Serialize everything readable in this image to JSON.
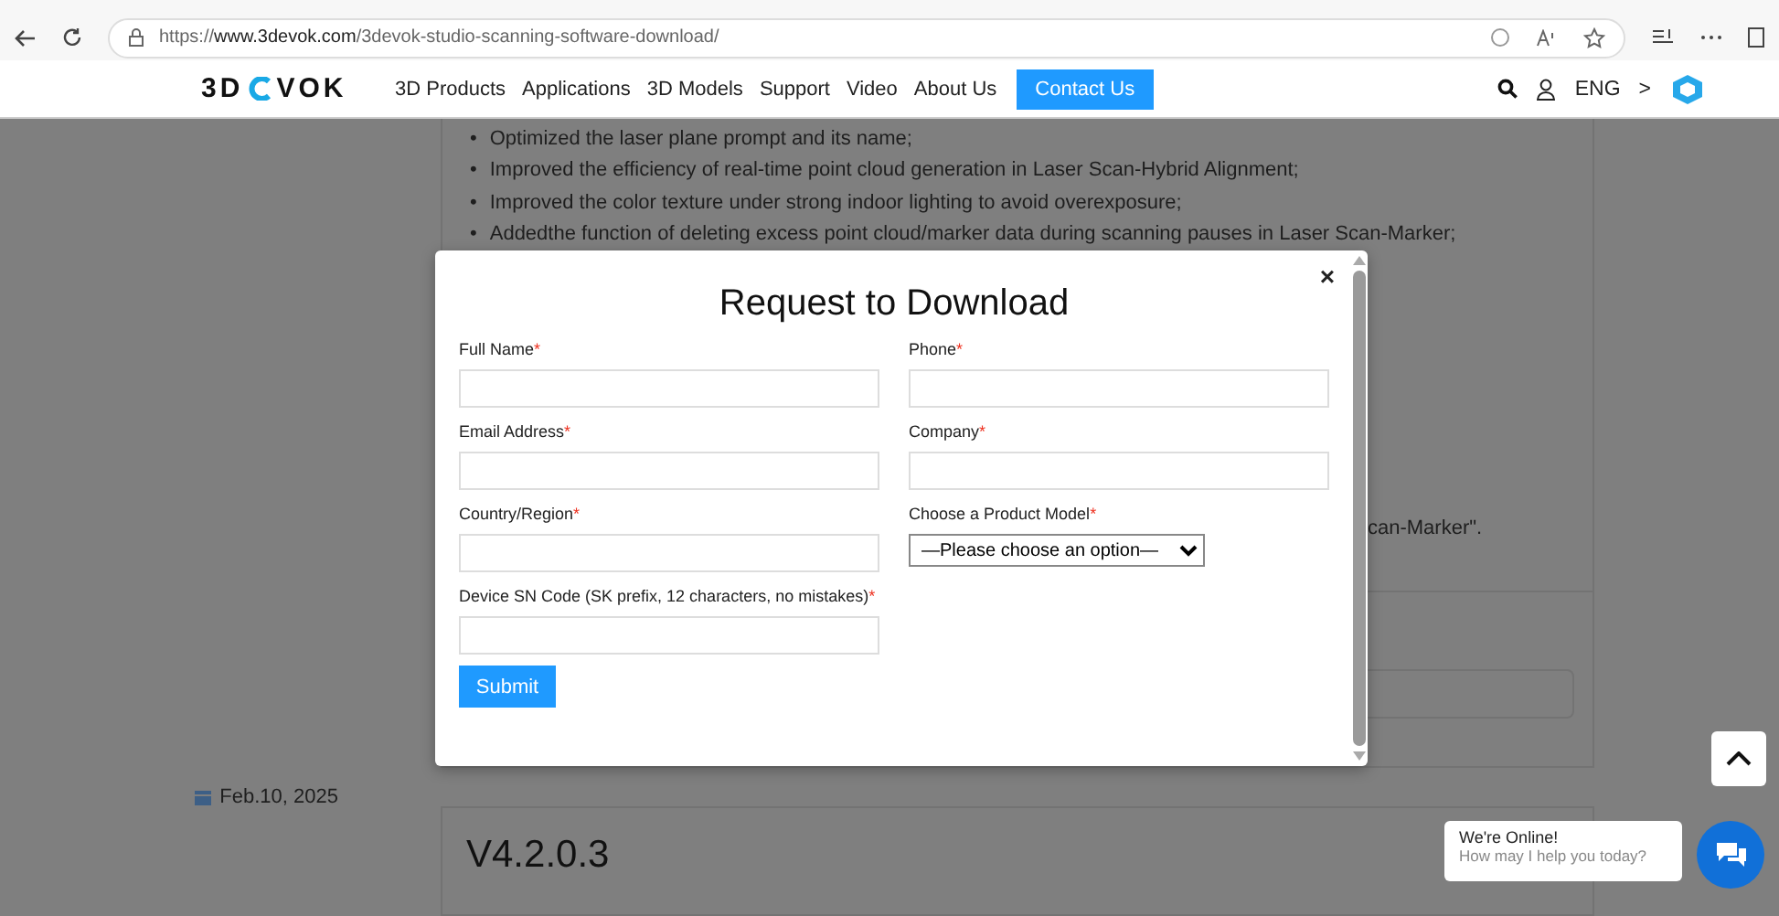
{
  "browser": {
    "url": "https://**www.3devok.com**/3devok-studio-scanning-software-download/"
  },
  "header": {
    "logo_left": "3D",
    "logo_right": "VOK",
    "nav": [
      {
        "label": "3D Products",
        "kind": "link"
      },
      {
        "label": "Applications",
        "kind": "link"
      },
      {
        "label": "3D Models",
        "kind": "link"
      },
      {
        "label": "Support",
        "kind": "link"
      },
      {
        "label": "Video",
        "kind": "link"
      },
      {
        "label": "About Us",
        "kind": "link"
      },
      {
        "label": "Contact Us",
        "kind": "button"
      }
    ],
    "language": "ENG",
    "language_arrow": ">"
  },
  "release_notes": {
    "marker": "•",
    "bullets": [
      "Optimized the laser plane prompt and its name;",
      "Improved the efficiency of real-time point cloud generation in Laser Scan-Hybrid Alignment;",
      "Improved the color texture under strong indoor lighting to avoid overexposure;",
      "Addedthe function of deleting excess point cloud/marker data during scanning pauses in Laser Scan-Marker;"
    ],
    "cut_text": "can-Marker\".",
    "date": "Feb.10, 2025",
    "version": "V4.2.0.3"
  },
  "modal": {
    "title": "Request to Download",
    "close": "×",
    "fields": [
      {
        "label": "Full Name",
        "mark": "*",
        "kind": "text"
      },
      {
        "label": "Phone",
        "mark": "*",
        "kind": "text"
      },
      {
        "label": "Email Address",
        "mark": "*",
        "kind": "text"
      },
      {
        "label": "Company",
        "mark": "*",
        "kind": "text"
      },
      {
        "label": "Country/Region",
        "mark": "*",
        "kind": "text"
      },
      {
        "label": "Choose a Product Model",
        "mark": "*",
        "kind": "select",
        "value": "—Please choose an option—"
      },
      {
        "label": "Device SN Code (SK prefix, 12 characters, no mistakes)",
        "mark": "*",
        "kind": "text"
      }
    ],
    "submit": "Submit"
  },
  "chat": {
    "title": "We're Online!",
    "subtitle": "How may I help you today?"
  }
}
